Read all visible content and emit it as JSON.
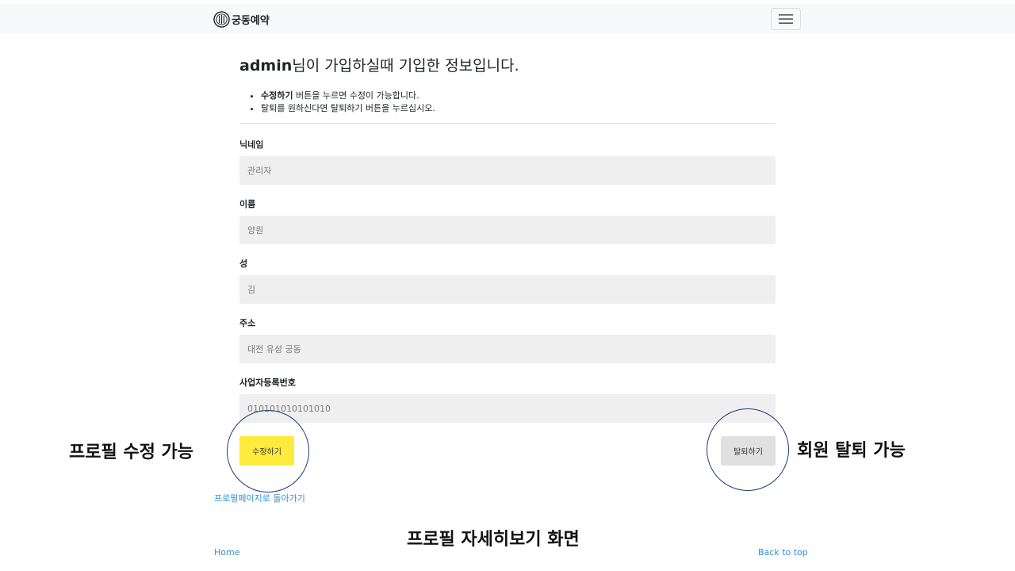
{
  "navbar": {
    "brand": "궁동예약",
    "logo_icon": "emblem-icon",
    "menu_icon": "hamburger-menu-icon"
  },
  "page": {
    "title_user": "admin",
    "title_suffix": "님이 가입하실때 기입한 정보입니다.",
    "notes": [
      {
        "bold": "수정하기",
        "text": " 버튼을 누르면 수정이 가능합니다."
      },
      {
        "bold": "",
        "text": "탈퇴를 원하신다면 탈퇴하기 버튼을 누르십시오."
      }
    ]
  },
  "fields": [
    {
      "label": "닉네임",
      "value": "관리자"
    },
    {
      "label": "이름",
      "value": "양원"
    },
    {
      "label": "성",
      "value": "김"
    },
    {
      "label": "주소",
      "value": "대전 유성 궁동"
    },
    {
      "label": "사업자등록번호",
      "value": "010101010101010"
    }
  ],
  "buttons": {
    "edit": "수정하기",
    "withdraw": "탈퇴하기",
    "edit_color": "#ffeb3b",
    "withdraw_color": "#e0e0e0"
  },
  "annotations": {
    "left": "프로필 수정 가능",
    "right": "회원 탈퇴 가능",
    "caption": "프로필 자세히보기 화면"
  },
  "links": {
    "back": "프로필페이지로 돌아가기",
    "home": "Home",
    "top": "Back to top",
    "link_color": "#2f8fd8"
  }
}
